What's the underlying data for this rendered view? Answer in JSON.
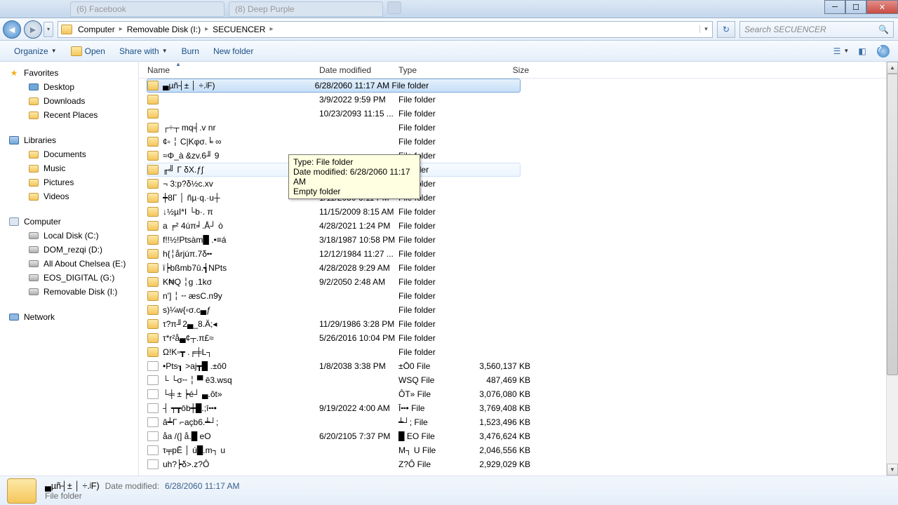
{
  "window": {
    "tabs": [
      "(6) Facebook",
      "(8) Deep Purple"
    ]
  },
  "breadcrumbs": [
    "Computer",
    "Removable Disk (I:)",
    "SECUENCER"
  ],
  "search_placeholder": "Search SECUENCER",
  "toolbar": {
    "organize": "Organize",
    "open": "Open",
    "share": "Share with",
    "burn": "Burn",
    "newfolder": "New folder"
  },
  "nav": {
    "favorites": "Favorites",
    "desktop": "Desktop",
    "downloads": "Downloads",
    "recent": "Recent Places",
    "libraries": "Libraries",
    "documents": "Documents",
    "music": "Music",
    "pictures": "Pictures",
    "videos": "Videos",
    "computer": "Computer",
    "localc": "Local Disk (C:)",
    "domd": "DOM_rezqi (D:)",
    "chelseae": "All About Chelsea (E:)",
    "eosg": "EOS_DIGITAL (G:)",
    "removablei": "Removable Disk (I:)",
    "network": "Network"
  },
  "columns": {
    "name": "Name",
    "date": "Date modified",
    "type": "Type",
    "size": "Size"
  },
  "tooltip": {
    "l1": "Type: File folder",
    "l2": "Date modified: 6/28/2060 11:17 AM",
    "l3": "Empty folder"
  },
  "rows": [
    {
      "icon": "folder",
      "name": "▄µñ┤± │ ÷.ʲF)",
      "date": "6/28/2060 11:17 AM",
      "type": "File folder",
      "size": "",
      "sel": true
    },
    {
      "icon": "folder",
      "name": "",
      "date": "3/9/2022 9:59 PM",
      "type": "File folder",
      "size": ""
    },
    {
      "icon": "folder",
      "name": "",
      "date": "10/23/2093 11:15 ...",
      "type": "File folder",
      "size": ""
    },
    {
      "icon": "folder",
      "name": "┌÷┬ mq╡.v nr",
      "date": "",
      "type": "File folder",
      "size": ""
    },
    {
      "icon": "folder",
      "name": "¢▫ ╎ C|Kφσ.╘ ∞",
      "date": "",
      "type": "File folder",
      "size": ""
    },
    {
      "icon": "folder",
      "name": "≈Φ_à  &zv.6╜ 9",
      "date": "",
      "type": "File folder",
      "size": ""
    },
    {
      "icon": "folder",
      "name": "╓╝ Γ  δX.ƒʃ",
      "date": "",
      "type": "File folder",
      "size": "",
      "hov": true
    },
    {
      "icon": "folder",
      "name": "¬ 3:p?δ½c.xv",
      "date": "",
      "type": "File folder",
      "size": ""
    },
    {
      "icon": "folder",
      "name": "┿8Γ │ ñµ·q.·u┼",
      "date": "1/11/2050 6:11 PM",
      "type": "File folder",
      "size": ""
    },
    {
      "icon": "folder",
      "name": "↓½µI*I └b·. π",
      "date": "11/15/2009 8:15 AM",
      "type": "File folder",
      "size": ""
    },
    {
      "icon": "folder",
      "name": "a ╒² 4úπ╛.Å┘ ò",
      "date": "4/28/2021 1:24 PM",
      "type": "File folder",
      "size": ""
    },
    {
      "icon": "folder",
      "name": "f!!½!Ptsàm█ .•≡á",
      "date": "3/18/1987 10:58 PM",
      "type": "File folder",
      "size": ""
    },
    {
      "icon": "folder",
      "name": "h{╎årjúπ.7δ╍",
      "date": "12/12/1984 11:27 ...",
      "type": "File folder",
      "size": ""
    },
    {
      "icon": "folder",
      "name": "ï┝bßmb7û.┪NPts",
      "date": "4/28/2028 9:29 AM",
      "type": "File folder",
      "size": ""
    },
    {
      "icon": "folder",
      "name": "K₦Q ╎g .1kσ",
      "date": "9/2/2050 2:48 AM",
      "type": "File folder",
      "size": ""
    },
    {
      "icon": "folder",
      "name": "n'] ╎ ╌ æsC.n9y",
      "date": "",
      "type": "File folder",
      "size": ""
    },
    {
      "icon": "folder",
      "name": "s)¼w{▫σ.c▄ƒ",
      "date": "",
      "type": "File folder",
      "size": ""
    },
    {
      "icon": "folder",
      "name": "τ?π╜2▄_8.Ä;◂",
      "date": "11/29/1986 3:28 PM",
      "type": "File folder",
      "size": ""
    },
    {
      "icon": "folder",
      "name": "τ*r²å▄¢┬.π£≈",
      "date": "5/26/2016 10:04 PM",
      "type": "File folder",
      "size": ""
    },
    {
      "icon": "folder",
      "name": "Ω!K▫┳  .╒╪L┐",
      "date": "",
      "type": "File folder",
      "size": ""
    },
    {
      "icon": "file",
      "name": "•Pts┒ >aj┳█ .±ō0",
      "date": "1/8/2038 3:38 PM",
      "type": "±Ō0 File",
      "size": "3,560,137 KB"
    },
    {
      "icon": "file",
      "name": "└ └σ╌ ╎ ▀ ē3.wsq",
      "date": "",
      "type": "WSQ File",
      "size": "487,469 KB"
    },
    {
      "icon": "file",
      "name": "└╪ ± ┝é┘ ▄.ôt»",
      "date": "",
      "type": "ÔT» File",
      "size": "3,076,080 KB"
    },
    {
      "icon": "file",
      "name": "┤ ┯┳ōb┿█.;ī╍•",
      "date": "9/19/2022 4:00 AM",
      "type": "Ī╍• File",
      "size": "3,769,408 KB"
    },
    {
      "icon": "file",
      "name": "â┷Γ ⌐açb6.┷┘;",
      "date": "",
      "type": "┷┘; File",
      "size": "1,523,496 KB"
    },
    {
      "icon": "file",
      "name": "åa /(] å.█  eO",
      "date": "6/20/2105 7:37 PM",
      "type": "█  EO File",
      "size": "3,476,624 KB"
    },
    {
      "icon": "file",
      "name": "τ╤pĒ │ ú█.m┐ u",
      "date": "",
      "type": "M┐ U File",
      "size": "2,046,556 KB"
    },
    {
      "icon": "file",
      "name": "uh?┝δ>.z?Ô",
      "date": "",
      "type": "Z?Ô File",
      "size": "2,929,029 KB"
    }
  ],
  "details": {
    "name": "▄µñ┤± │ ÷.ʲF)",
    "date_label": "Date modified:",
    "date_val": "6/28/2060 11:17 AM",
    "type": "File folder"
  }
}
